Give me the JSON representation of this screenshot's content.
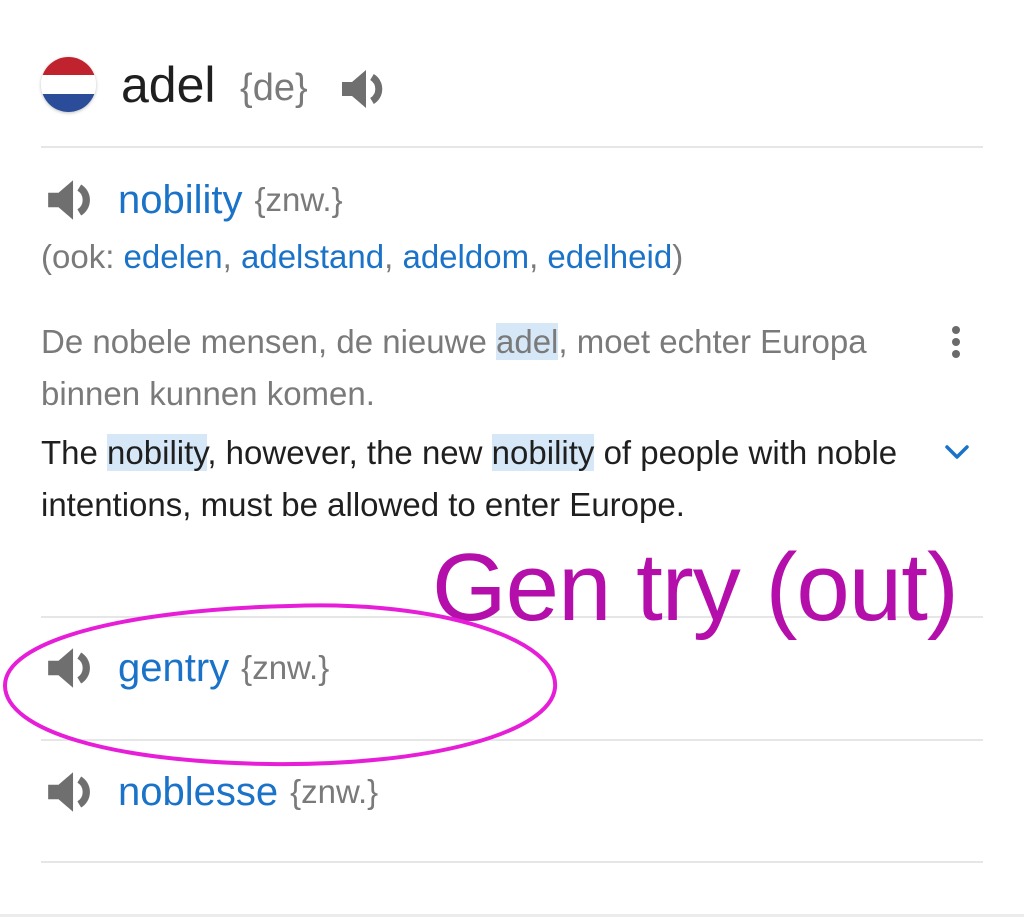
{
  "header": {
    "word": "adel",
    "gender": "{de}",
    "flag_icon": "netherlands-flag-icon",
    "speaker_icon": "speaker-icon"
  },
  "entries": [
    {
      "word": "nobility",
      "pos": "{znw.}",
      "also": {
        "prefix": "(ook: ",
        "terms": [
          "edelen",
          "adelstand",
          "adeldom",
          "edelheid"
        ],
        "separator": ", ",
        "suffix": ")"
      },
      "example": {
        "nl": {
          "before": "De nobele mensen, de nieuwe ",
          "highlight": "adel",
          "after": ", moet echter Europa binnen kunnen komen."
        },
        "en": {
          "part1": "The ",
          "highlight1": "nobility",
          "part2": ", however, the new ",
          "highlight2": "nobility",
          "part3": " of people with noble intentions, must be allowed to enter Europe."
        }
      }
    },
    {
      "word": "gentry",
      "pos": "{znw.}"
    },
    {
      "word": "noblesse",
      "pos": "{znw.}"
    }
  ],
  "annotation": {
    "text": "Gen try (out)",
    "color": "#b40faa",
    "ellipse_color": "#e61ed8"
  },
  "colors": {
    "link": "#1a73c8",
    "muted": "#7a7a7a",
    "highlight": "#d6e8f7",
    "separator": "#e6e6e6"
  }
}
